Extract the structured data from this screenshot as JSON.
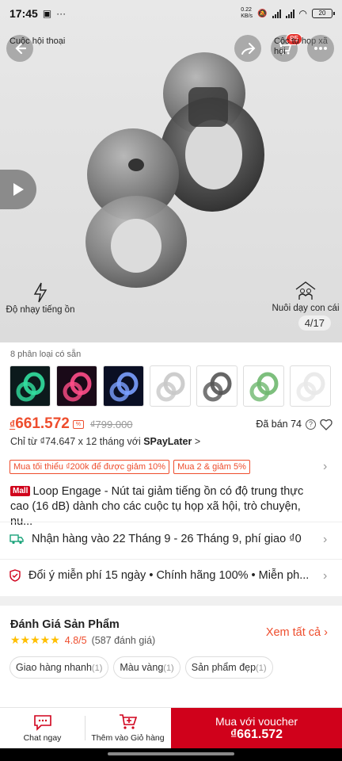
{
  "status": {
    "time": "17:45",
    "net_speed": "0.22\nKB/s",
    "battery": "20"
  },
  "hero": {
    "chat_label": "Cuộc hội thoại",
    "cart_badge": "85",
    "group_label": "Cộc tụ họp xã hội",
    "feature_left": "Độ nhạy tiếng ồn",
    "feature_right": "Nuôi dạy con cái",
    "counter": "4/17"
  },
  "variants": {
    "title": "8 phân loại có sẵn",
    "thumbs": [
      {
        "bg": "#0c1a1c",
        "color": "#32e0a0"
      },
      {
        "bg": "#1a0a18",
        "color": "#ff4d88"
      },
      {
        "bg": "#0a0f24",
        "color": "#7aa0ff"
      },
      {
        "bg": "#ffffff",
        "color": "#c8c8c8"
      },
      {
        "bg": "#ffffff",
        "color": "#555555"
      },
      {
        "bg": "#ffffff",
        "color": "#6fb86f"
      },
      {
        "bg": "#ffffff",
        "color": "#e8e8e8"
      }
    ]
  },
  "price": {
    "current_symbol": "₫",
    "current": "661.572",
    "old": "₫799.000",
    "sold": "Đã bán 74"
  },
  "installment": {
    "prefix": "Chỉ từ ₫74.647 x 12 tháng với ",
    "brand": "SPayLater",
    "suffix": " >"
  },
  "vouchers": [
    "Mua tối thiểu ₫200k để được giảm 10%",
    "Mua 2 & giảm 5%"
  ],
  "product": {
    "mall_label": "Mall",
    "title": "Loop Engage - Nút tai giảm tiếng ồn có độ trung thực cao (16 dB) dành cho các cuộc tụ họp xã hội, trò chuyện, nu..."
  },
  "shipping": {
    "text": "Nhận hàng vào 22 Tháng 9 - 26 Tháng 9, phí giao ₫0"
  },
  "guarantee": {
    "text": "Đổi ý miễn phí 15 ngày  •  Chính hãng 100%  •  Miễn ph..."
  },
  "reviews": {
    "title": "Đánh Giá Sản Phẩm",
    "stars": "★★★★★",
    "score": "4.8/5",
    "count": "(587 đánh giá)",
    "see_all": "Xem tất cả",
    "rating_value": 4.8,
    "chips": [
      {
        "label": "Giao hàng nhanh",
        "count": "(1)"
      },
      {
        "label": "Màu vàng",
        "count": "(1)"
      },
      {
        "label": "Sản phẩm đẹp",
        "count": "(1)"
      }
    ]
  },
  "bottom_bar": {
    "chat": "Chat ngay",
    "add_cart": "Thêm vào Giỏ hàng",
    "buy_line1": "Mua với voucher",
    "buy_line2": "₫661.572"
  },
  "colors": {
    "accent": "#ee4d2d",
    "mall_red": "#d0011b",
    "star": "#ffbf00"
  }
}
